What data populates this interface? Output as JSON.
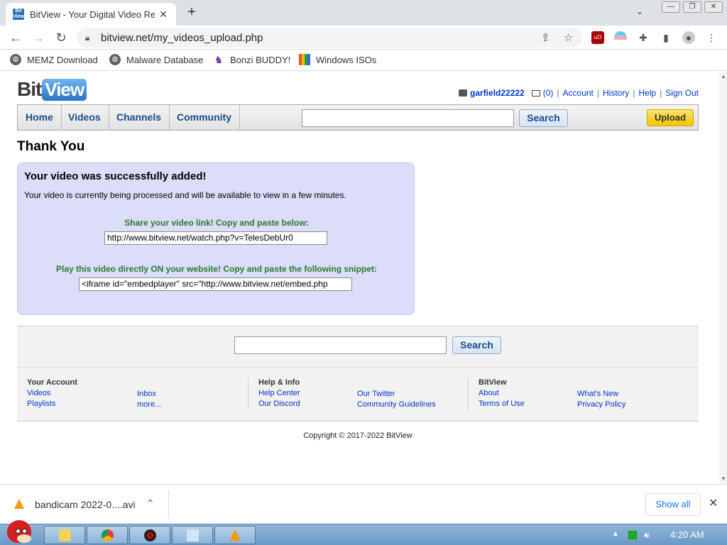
{
  "browser": {
    "tab_title": "BitView - Your Digital Video Re",
    "favicon_text": "Bit View",
    "tab_close": "✕",
    "newtab": "+",
    "url": "bitview.net/my_videos_upload.php",
    "bookmarks": [
      {
        "label": "MEMZ Download",
        "icon": "globe-icon"
      },
      {
        "label": "Malware Database",
        "icon": "globe-icon"
      },
      {
        "label": "Bonzi BUDDY!",
        "icon": "bonzi-icon"
      },
      {
        "label": "Windows ISOs",
        "icon": "windows-flag-icon"
      }
    ]
  },
  "site": {
    "logo_bit": "Bit",
    "logo_view": "View",
    "username": "garfield22222",
    "mail_count": "(0)",
    "links": {
      "account": "Account",
      "history": "History",
      "help": "Help",
      "signout": "Sign Out"
    },
    "nav": [
      "Home",
      "Videos",
      "Channels",
      "Community"
    ],
    "search_button": "Search",
    "upload_button": "Upload"
  },
  "main": {
    "heading": "Thank You",
    "panel_title": "Your video was successfully added!",
    "panel_text": "Your video is currently being processed and will be available to view in a few minutes.",
    "share_label": "Share your video link! Copy and paste below:",
    "share_value": "http://www.bitview.net/watch.php?v=TelesDebUr0",
    "embed_label": "Play this video directly ON your website! Copy and paste the following snippet:",
    "embed_value": "<iframe id=\"embedplayer\" src=\"http://www.bitview.net/embed.php"
  },
  "footer": {
    "search_button": "Search",
    "your_account": {
      "title": "Your Account",
      "links": [
        "Videos",
        "Playlists",
        "Inbox",
        "more..."
      ]
    },
    "help_info": {
      "title": "Help & Info",
      "links": [
        "Help Center",
        "Our Discord",
        "Our Twitter",
        "Community Guidelines"
      ]
    },
    "bitview": {
      "title": "BitView",
      "links": [
        "About",
        "Terms of Use",
        "What's New",
        "Privacy Policy"
      ]
    },
    "copyright": "Copyright © 2017-2022 BitView"
  },
  "downloads": {
    "file": "bandicam 2022-0....avi",
    "show_all": "Show all"
  },
  "taskbar": {
    "time": "4:20 AM"
  }
}
